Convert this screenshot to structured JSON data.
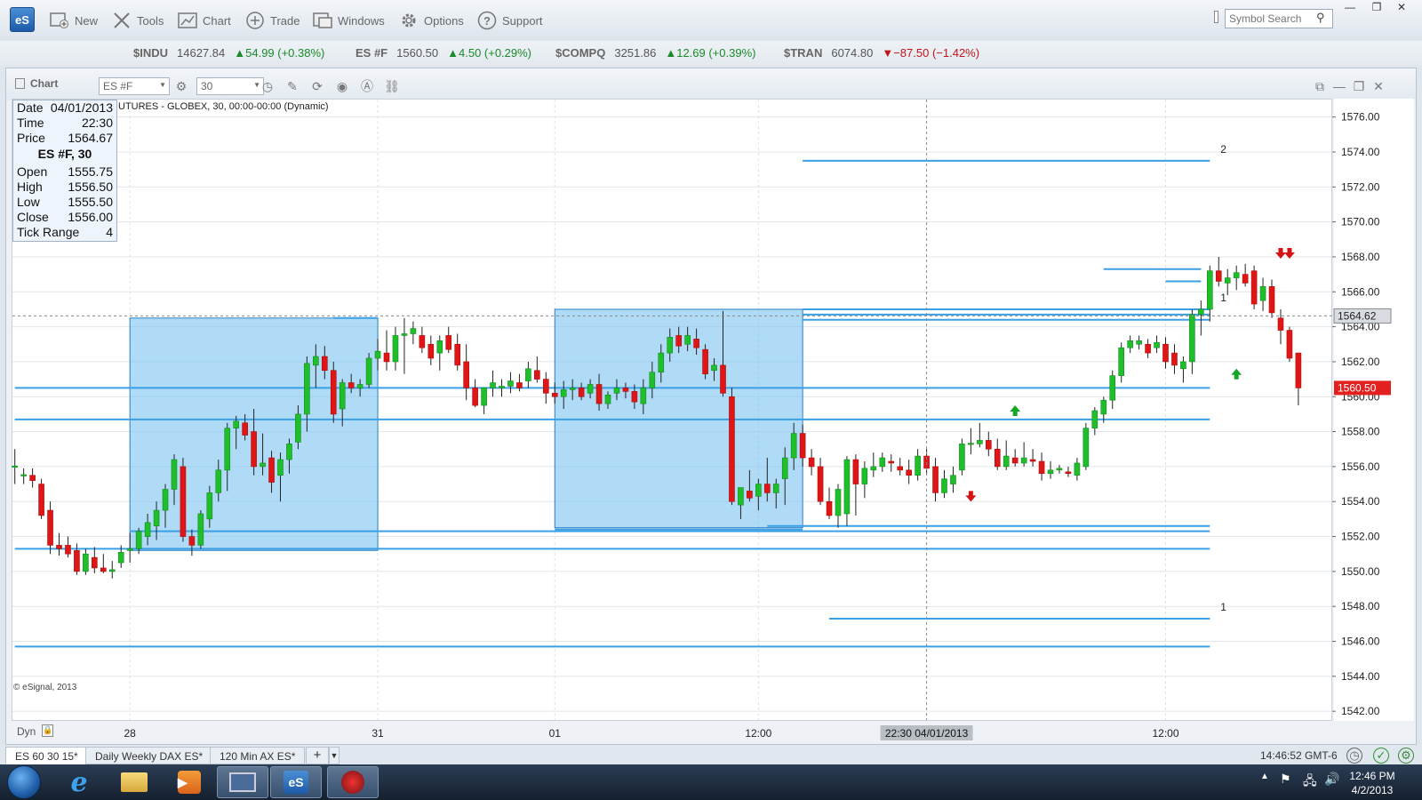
{
  "toolbar": {
    "app_logo": "eS",
    "new_label": "New",
    "tools_label": "Tools",
    "chart_label": "Chart",
    "trade_label": "Trade",
    "windows_label": "Windows",
    "options_label": "Options",
    "support_label": "Support",
    "symbol_search_placeholder": "Symbol Search"
  },
  "tickers": [
    {
      "symbol": "$INDU",
      "price": "14627.84",
      "change": "▲54.99 (+0.38%)",
      "dir": "up"
    },
    {
      "symbol": "ES #F",
      "price": "1560.50",
      "change": "▲4.50 (+0.29%)",
      "dir": "up"
    },
    {
      "symbol": "$COMPQ",
      "price": "3251.86",
      "change": "▲12.69 (+0.39%)",
      "dir": "up"
    },
    {
      "symbol": "$TRAN",
      "price": "6074.80",
      "change": "▼−87.50 (−1.42%)",
      "dir": "down"
    }
  ],
  "chart_window": {
    "title": "Chart",
    "symbol": "ES #F",
    "interval": "30",
    "caption": "UTURES - GLOBEX, 30, 00:00-00:00 (Dynamic)",
    "copyright": "© eSignal, 2013",
    "dyn_label": "Dyn"
  },
  "data_window": {
    "date_label": "Date",
    "date": "04/01/2013",
    "time_label": "Time",
    "time": "22:30",
    "price_label": "Price",
    "price": "1564.67",
    "symbol": "ES #F, 30",
    "open_label": "Open",
    "open": "1555.75",
    "high_label": "High",
    "high": "1556.50",
    "low_label": "Low",
    "low": "1555.50",
    "close_label": "Close",
    "close": "1556.00",
    "range_label": "Tick Range",
    "range": "4"
  },
  "chart_data": {
    "type": "candlestick",
    "y_ticks": [
      "1576.00",
      "1574.00",
      "1572.00",
      "1570.00",
      "1568.00",
      "1566.00",
      "1564.00",
      "1562.00",
      "1560.00",
      "1558.00",
      "1556.00",
      "1554.00",
      "1552.00",
      "1550.00",
      "1548.00",
      "1546.00",
      "1544.00",
      "1542.00"
    ],
    "ylim": [
      1541.5,
      1577
    ],
    "x_ticks": [
      {
        "bar": 13,
        "label": "28"
      },
      {
        "bar": 41,
        "label": "31"
      },
      {
        "bar": 61,
        "label": "01"
      },
      {
        "bar": 84,
        "label": "12:00"
      },
      {
        "bar": 130,
        "label": "12:00"
      }
    ],
    "crosshair": {
      "bar": 103,
      "price": 1564.62,
      "time_label": "22:30 04/01/2013",
      "price_label": "1564.62"
    },
    "last_price": {
      "price": 1560.5,
      "label": "1560.50"
    },
    "candles": [
      [
        1556.0,
        1557.0,
        1555.0,
        1556.0
      ],
      [
        1555.5,
        1555.9,
        1555.0,
        1555.5
      ],
      [
        1555.5,
        1555.9,
        1554.8,
        1555.2
      ],
      [
        1555.0,
        1555.3,
        1553.0,
        1553.2
      ],
      [
        1553.5,
        1554.0,
        1551.0,
        1551.5
      ],
      [
        1551.5,
        1552.2,
        1550.9,
        1551.3
      ],
      [
        1551.5,
        1552.0,
        1550.8,
        1551.0
      ],
      [
        1551.2,
        1551.6,
        1549.8,
        1550.0
      ],
      [
        1550.0,
        1551.3,
        1549.8,
        1551.0
      ],
      [
        1550.8,
        1551.4,
        1549.9,
        1550.2
      ],
      [
        1550.2,
        1551.0,
        1549.9,
        1550.0
      ],
      [
        1550.0,
        1550.6,
        1549.6,
        1550.1
      ],
      [
        1550.5,
        1551.5,
        1550.2,
        1551.1
      ],
      [
        1551.2,
        1552.2,
        1550.5,
        1551.3
      ],
      [
        1551.3,
        1552.5,
        1551.0,
        1552.3
      ],
      [
        1552.0,
        1553.3,
        1551.5,
        1552.8
      ],
      [
        1552.6,
        1554.0,
        1551.8,
        1553.5
      ],
      [
        1553.5,
        1555.0,
        1552.5,
        1554.7
      ],
      [
        1554.7,
        1556.7,
        1553.8,
        1556.4
      ],
      [
        1556.0,
        1556.5,
        1551.7,
        1552.0
      ],
      [
        1552.0,
        1552.4,
        1550.9,
        1551.5
      ],
      [
        1551.5,
        1553.5,
        1551.3,
        1553.3
      ],
      [
        1553.0,
        1554.9,
        1552.5,
        1554.5
      ],
      [
        1554.5,
        1556.4,
        1554.0,
        1555.8
      ],
      [
        1555.8,
        1558.5,
        1554.6,
        1558.2
      ],
      [
        1558.2,
        1558.9,
        1557.0,
        1558.6
      ],
      [
        1558.5,
        1559.0,
        1557.5,
        1557.8
      ],
      [
        1558.0,
        1559.3,
        1555.5,
        1556.0
      ],
      [
        1556.0,
        1557.9,
        1555.5,
        1556.2
      ],
      [
        1556.5,
        1556.9,
        1554.5,
        1555.1
      ],
      [
        1555.5,
        1556.8,
        1554.0,
        1556.4
      ],
      [
        1556.4,
        1557.6,
        1555.6,
        1557.3
      ],
      [
        1557.4,
        1559.5,
        1557.0,
        1559.0
      ],
      [
        1559.0,
        1562.3,
        1558.0,
        1561.9
      ],
      [
        1561.8,
        1563.0,
        1560.5,
        1562.3
      ],
      [
        1562.3,
        1562.9,
        1561.0,
        1561.5
      ],
      [
        1561.5,
        1562.0,
        1558.5,
        1559.0
      ],
      [
        1559.3,
        1561.0,
        1558.3,
        1560.8
      ],
      [
        1560.8,
        1561.3,
        1560.2,
        1560.5
      ],
      [
        1560.5,
        1561.0,
        1560.0,
        1560.7
      ],
      [
        1560.7,
        1562.5,
        1560.5,
        1562.2
      ],
      [
        1562.2,
        1563.3,
        1561.5,
        1562.6
      ],
      [
        1562.5,
        1563.8,
        1561.5,
        1562.0
      ],
      [
        1562.0,
        1564.0,
        1561.5,
        1563.5
      ],
      [
        1563.5,
        1564.5,
        1561.3,
        1563.6
      ],
      [
        1563.6,
        1564.3,
        1563.0,
        1563.9
      ],
      [
        1563.5,
        1564.0,
        1562.5,
        1562.8
      ],
      [
        1563.0,
        1563.5,
        1561.8,
        1562.2
      ],
      [
        1562.5,
        1563.5,
        1561.5,
        1563.2
      ],
      [
        1563.5,
        1564.0,
        1562.5,
        1562.7
      ],
      [
        1563.0,
        1563.6,
        1561.5,
        1561.8
      ],
      [
        1562.0,
        1563.0,
        1559.8,
        1560.5
      ],
      [
        1560.5,
        1561.0,
        1559.4,
        1559.5
      ],
      [
        1559.5,
        1560.5,
        1559.0,
        1560.5
      ],
      [
        1560.5,
        1561.5,
        1560.0,
        1560.8
      ],
      [
        1560.5,
        1561.0,
        1560.0,
        1560.6
      ],
      [
        1560.6,
        1561.4,
        1560.2,
        1560.9
      ],
      [
        1560.8,
        1561.3,
        1560.3,
        1560.5
      ],
      [
        1560.9,
        1562.0,
        1560.5,
        1561.6
      ],
      [
        1561.5,
        1562.3,
        1560.8,
        1561.0
      ],
      [
        1561.0,
        1561.4,
        1559.6,
        1560.2
      ],
      [
        1560.2,
        1560.8,
        1559.6,
        1560.0
      ],
      [
        1560.0,
        1560.9,
        1559.3,
        1560.4
      ],
      [
        1560.4,
        1561.0,
        1559.8,
        1560.5
      ],
      [
        1560.5,
        1560.8,
        1559.8,
        1560.0
      ],
      [
        1560.2,
        1561.0,
        1559.9,
        1560.7
      ],
      [
        1560.7,
        1561.3,
        1559.2,
        1559.6
      ],
      [
        1559.6,
        1560.3,
        1559.3,
        1560.1
      ],
      [
        1560.2,
        1561.0,
        1559.8,
        1560.5
      ],
      [
        1560.5,
        1560.8,
        1559.9,
        1560.3
      ],
      [
        1560.3,
        1560.7,
        1559.3,
        1559.7
      ],
      [
        1559.6,
        1561.0,
        1559.0,
        1560.5
      ],
      [
        1560.5,
        1562.0,
        1559.9,
        1561.4
      ],
      [
        1561.4,
        1563.0,
        1560.8,
        1562.5
      ],
      [
        1562.5,
        1563.9,
        1562.0,
        1563.4
      ],
      [
        1563.5,
        1564.0,
        1562.5,
        1562.9
      ],
      [
        1563.0,
        1564.0,
        1562.6,
        1563.5
      ],
      [
        1563.3,
        1563.9,
        1562.4,
        1562.8
      ],
      [
        1562.7,
        1563.0,
        1561.0,
        1561.3
      ],
      [
        1561.5,
        1562.2,
        1560.9,
        1561.8
      ],
      [
        1561.8,
        1564.9,
        1560.0,
        1560.2
      ],
      [
        1560.0,
        1560.5,
        1553.8,
        1554.0
      ],
      [
        1553.8,
        1554.8,
        1553.0,
        1554.8
      ],
      [
        1554.6,
        1555.8,
        1554.0,
        1554.2
      ],
      [
        1554.3,
        1555.3,
        1553.5,
        1555.0
      ],
      [
        1555.0,
        1556.5,
        1554.0,
        1554.5
      ],
      [
        1554.5,
        1555.3,
        1553.6,
        1555.0
      ],
      [
        1555.3,
        1557.1,
        1553.8,
        1556.5
      ],
      [
        1556.5,
        1558.5,
        1555.8,
        1557.9
      ],
      [
        1557.9,
        1558.4,
        1556.0,
        1556.5
      ],
      [
        1556.5,
        1557.0,
        1555.5,
        1556.0
      ],
      [
        1556.0,
        1556.5,
        1553.8,
        1554.0
      ],
      [
        1554.0,
        1554.8,
        1553.0,
        1553.2
      ],
      [
        1553.2,
        1555.0,
        1552.5,
        1554.7
      ],
      [
        1553.3,
        1556.6,
        1552.6,
        1556.4
      ],
      [
        1556.4,
        1556.7,
        1553.2,
        1555.0
      ],
      [
        1555.0,
        1556.3,
        1554.2,
        1555.9
      ],
      [
        1555.8,
        1556.8,
        1555.4,
        1556.0
      ],
      [
        1556.0,
        1556.8,
        1555.7,
        1556.5
      ],
      [
        1556.3,
        1556.7,
        1555.7,
        1556.2
      ],
      [
        1556.0,
        1556.5,
        1555.5,
        1555.8
      ],
      [
        1555.8,
        1556.4,
        1555.0,
        1555.5
      ],
      [
        1555.5,
        1557.0,
        1555.2,
        1556.6
      ],
      [
        1556.6,
        1557.0,
        1555.5,
        1555.9
      ],
      [
        1556.0,
        1556.5,
        1554.0,
        1554.5
      ],
      [
        1554.5,
        1555.8,
        1554.2,
        1555.3
      ],
      [
        1555.0,
        1556.0,
        1554.5,
        1555.5
      ],
      [
        1555.8,
        1557.6,
        1555.5,
        1557.3
      ],
      [
        1557.3,
        1558.2,
        1556.7,
        1557.3
      ],
      [
        1557.3,
        1558.5,
        1557.1,
        1557.5
      ],
      [
        1557.5,
        1558.0,
        1556.6,
        1557.0
      ],
      [
        1557.0,
        1557.6,
        1555.8,
        1556.0
      ],
      [
        1556.0,
        1557.5,
        1555.8,
        1556.6
      ],
      [
        1556.5,
        1557.0,
        1556.0,
        1556.2
      ],
      [
        1556.2,
        1557.4,
        1556.0,
        1556.5
      ],
      [
        1556.4,
        1557.0,
        1556.0,
        1556.3
      ],
      [
        1556.3,
        1556.8,
        1555.2,
        1555.6
      ],
      [
        1555.6,
        1556.3,
        1555.3,
        1555.8
      ],
      [
        1555.8,
        1556.1,
        1555.6,
        1555.9
      ],
      [
        1555.7,
        1556.0,
        1555.4,
        1555.6
      ],
      [
        1555.5,
        1556.5,
        1555.2,
        1556.2
      ],
      [
        1556.0,
        1558.5,
        1555.8,
        1558.2
      ],
      [
        1558.2,
        1559.4,
        1557.8,
        1559.2
      ],
      [
        1559.0,
        1560.0,
        1558.5,
        1559.8
      ],
      [
        1559.8,
        1561.5,
        1559.3,
        1561.2
      ],
      [
        1561.2,
        1563.1,
        1560.8,
        1562.8
      ],
      [
        1562.8,
        1563.5,
        1562.5,
        1563.2
      ],
      [
        1563.0,
        1563.5,
        1562.7,
        1563.2
      ],
      [
        1563.0,
        1563.3,
        1562.2,
        1562.5
      ],
      [
        1562.8,
        1563.5,
        1562.5,
        1563.1
      ],
      [
        1563.0,
        1563.4,
        1561.6,
        1562.0
      ],
      [
        1562.5,
        1563.0,
        1561.3,
        1561.8
      ],
      [
        1561.6,
        1562.3,
        1560.8,
        1562.0
      ],
      [
        1562.0,
        1565.0,
        1561.3,
        1564.7
      ],
      [
        1564.7,
        1565.5,
        1563.5,
        1565.0
      ],
      [
        1565.0,
        1567.5,
        1564.3,
        1567.2
      ],
      [
        1567.2,
        1568.0,
        1566.3,
        1566.6
      ],
      [
        1566.5,
        1567.3,
        1565.8,
        1566.8
      ],
      [
        1566.8,
        1567.5,
        1566.1,
        1567.1
      ],
      [
        1567.0,
        1567.6,
        1566.3,
        1566.5
      ],
      [
        1567.2,
        1567.5,
        1565.0,
        1565.3
      ],
      [
        1565.5,
        1566.8,
        1564.9,
        1566.3
      ],
      [
        1566.3,
        1566.7,
        1564.5,
        1564.8
      ],
      [
        1564.5,
        1565.0,
        1563.0,
        1563.8
      ],
      [
        1563.8,
        1564.0,
        1562.0,
        1562.2
      ],
      [
        1562.5,
        1562.5,
        1559.5,
        1560.5
      ]
    ],
    "arrows": [
      {
        "bar": 108,
        "price": 1554.3,
        "dir": "down"
      },
      {
        "bar": 113,
        "price": 1559.2,
        "dir": "up"
      },
      {
        "bar": 138,
        "price": 1561.3,
        "dir": "up"
      },
      {
        "bar": 143,
        "price": 1568.2,
        "dir": "down"
      },
      {
        "bar": 144,
        "price": 1568.2,
        "dir": "down"
      }
    ],
    "boxes": [
      {
        "x1": 13,
        "x2": 41,
        "top": 1564.5,
        "bottom": 1551.2
      },
      {
        "x1": 61,
        "x2": 89,
        "top": 1565.0,
        "bottom": 1552.5
      }
    ],
    "hlines": [
      {
        "price": 1573.5,
        "x1": 89,
        "x2": 135,
        "label": "2"
      },
      {
        "price": 1547.3,
        "x1": 92,
        "x2": 135,
        "label": "1"
      },
      {
        "price": 1560.5,
        "x1": 0,
        "x2": 135,
        "label": ""
      },
      {
        "price": 1558.7,
        "x1": 0,
        "x2": 135,
        "label": ""
      },
      {
        "price": 1551.3,
        "x1": 0,
        "x2": 135,
        "label": ""
      },
      {
        "price": 1545.7,
        "x1": 0,
        "x2": 135,
        "label": ""
      },
      {
        "price": 1552.3,
        "x1": 13,
        "x2": 135,
        "label": ""
      },
      {
        "price": 1552.6,
        "x1": 85,
        "x2": 135,
        "label": ""
      },
      {
        "price": 1552.4,
        "x1": 61,
        "x2": 89,
        "label": ""
      },
      {
        "price": 1565.0,
        "x1": 89,
        "x2": 135,
        "label": "1"
      },
      {
        "price": 1564.7,
        "x1": 89,
        "x2": 135,
        "label": ""
      },
      {
        "price": 1564.4,
        "x1": 89,
        "x2": 135,
        "label": ""
      },
      {
        "price": 1564.5,
        "x1": 36,
        "x2": 41,
        "label": ""
      },
      {
        "price": 1567.3,
        "x1": 123,
        "x2": 134,
        "label": ""
      },
      {
        "price": 1566.6,
        "x1": 130,
        "x2": 134,
        "label": ""
      }
    ]
  },
  "tabs": [
    {
      "label": "ES 60 30 15*",
      "active": true
    },
    {
      "label": "Daily Weekly DAX ES*",
      "active": false
    },
    {
      "label": "120 Min AX ES*",
      "active": false
    }
  ],
  "status": {
    "time": "14:46:52 GMT-6"
  },
  "taskbar": {
    "es_label": "eS",
    "clock_time": "12:46 PM",
    "clock_date": "4/2/2013"
  },
  "colors": {
    "up": "#1fbf2c",
    "down": "#e01616",
    "box_fill": "#7cc3f2",
    "line": "#3aa0e6",
    "accent": "#1d5aa8"
  }
}
